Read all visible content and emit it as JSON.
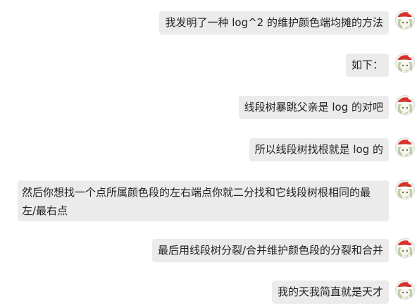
{
  "messages": [
    {
      "text": "我发明了一种 log^2 的维护颜色端均摊的方法"
    },
    {
      "text": "如下："
    },
    {
      "text": "线段树暴跳父亲是 log 的对吧"
    },
    {
      "text": "所以线段树找根就是 log 的"
    },
    {
      "text": "然后你想找一个点所属颜色段的左右端点你就二分找和它线段树根相同的最左/最右点"
    },
    {
      "text": "最后用线段树分裂/合并维护颜色段的分裂和合并"
    },
    {
      "text": "我的天我简直就是天才"
    }
  ],
  "avatar_icon": "anime-girl-santa-hat-avatar",
  "colors": {
    "bubble": "#ebebeb",
    "text": "#222222",
    "hat_red": "#d8312c",
    "hair_green": "#b9cfa6"
  }
}
